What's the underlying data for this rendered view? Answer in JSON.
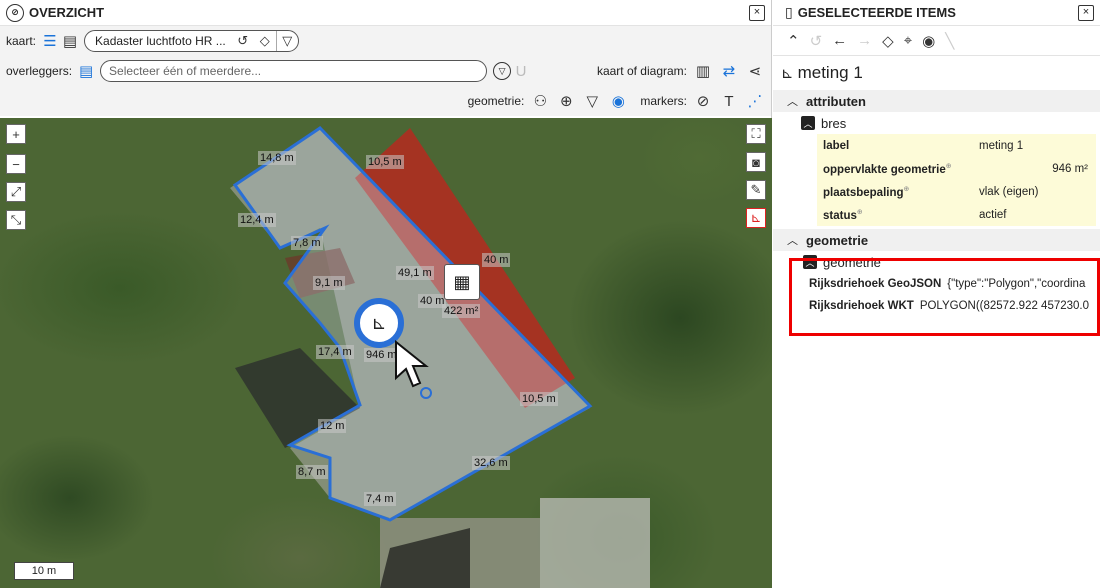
{
  "left_panel": {
    "title": "OVERZICHT",
    "close": "×",
    "kaart_label": "kaart:",
    "kaart_value": "Kadaster luchtfoto HR ...",
    "overleggers_label": "overleggers:",
    "overleggers_placeholder": "Selecteer één of meerdere...",
    "kaart_of_diagram": "kaart of diagram:",
    "geometrie_label": "geometrie:",
    "markers_label": "markers:"
  },
  "map": {
    "scale_label": "10 m",
    "labels": {
      "l1": "14,8 m",
      "l2": "10,5 m",
      "l3": "12,4 m",
      "l4": "7,8 m",
      "l5": "9,1 m",
      "l6": "49,1 m",
      "l7": "40 m",
      "l8": "40 m",
      "l9": "422 m²",
      "l10": "17,4 m",
      "l11": "946 m²",
      "l12": "10,5 m",
      "l13": "12 m",
      "l14": "8,7 m",
      "l15": "32,6 m",
      "l16": "7,4 m"
    }
  },
  "right_panel": {
    "title": "GESELECTEERDE ITEMS",
    "close": "×",
    "feature_title": "meting 1",
    "section_attributen": "attributen",
    "sub_bres": "bres",
    "attributes": [
      {
        "key": "label",
        "value": "meting 1"
      },
      {
        "key": "oppervlakte geometrie",
        "value": "946 m²"
      },
      {
        "key": "plaatsbepaling",
        "value": "vlak (eigen)"
      },
      {
        "key": "status",
        "value": "actief"
      }
    ],
    "section_geometrie": "geometrie",
    "sub_geometrie": "geometrie",
    "geo_rows": [
      {
        "key": "Rijksdriehoek GeoJSON",
        "value": "{\"type\":\"Polygon\",\"coordina"
      },
      {
        "key": "Rijksdriehoek WKT",
        "value": "POLYGON((82572.922 457230.0"
      }
    ]
  },
  "colors": {
    "accent": "#1a73d9",
    "polygon_stroke": "#2a6fd6",
    "building_fill": "#b52a20",
    "highlight": "#e00000"
  }
}
